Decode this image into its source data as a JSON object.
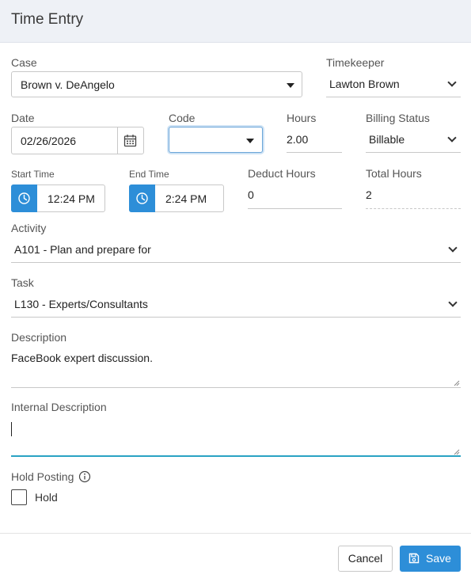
{
  "header": {
    "title": "Time Entry"
  },
  "case": {
    "label": "Case",
    "value": "Brown v. DeAngelo"
  },
  "timekeeper": {
    "label": "Timekeeper",
    "value": "Lawton Brown"
  },
  "date": {
    "label": "Date",
    "value": "02/26/2026"
  },
  "code": {
    "label": "Code",
    "value": ""
  },
  "hours": {
    "label": "Hours",
    "value": "2.00"
  },
  "billing_status": {
    "label": "Billing Status",
    "value": "Billable"
  },
  "start_time": {
    "label": "Start Time",
    "value": "12:24 PM"
  },
  "end_time": {
    "label": "End Time",
    "value": "2:24 PM"
  },
  "deduct_hours": {
    "label": "Deduct Hours",
    "value": "0"
  },
  "total_hours": {
    "label": "Total Hours",
    "value": "2"
  },
  "activity": {
    "label": "Activity",
    "value": "A101 - Plan and prepare for"
  },
  "task": {
    "label": "Task",
    "value": "L130 - Experts/Consultants"
  },
  "description": {
    "label": "Description",
    "value": "FaceBook expert discussion."
  },
  "internal_description": {
    "label": "Internal Description",
    "value": ""
  },
  "hold_posting": {
    "label": "Hold Posting",
    "checkbox_label": "Hold",
    "checked": false
  },
  "footer": {
    "cancel_label": "Cancel",
    "save_label": "Save"
  },
  "colors": {
    "accent": "#2d8ed8",
    "focus": "#2aa3c3",
    "header_bg": "#eef1f6"
  },
  "icons": [
    "calendar-icon",
    "clock-icon",
    "info-icon",
    "save-icon",
    "chevron-down-icon"
  ]
}
